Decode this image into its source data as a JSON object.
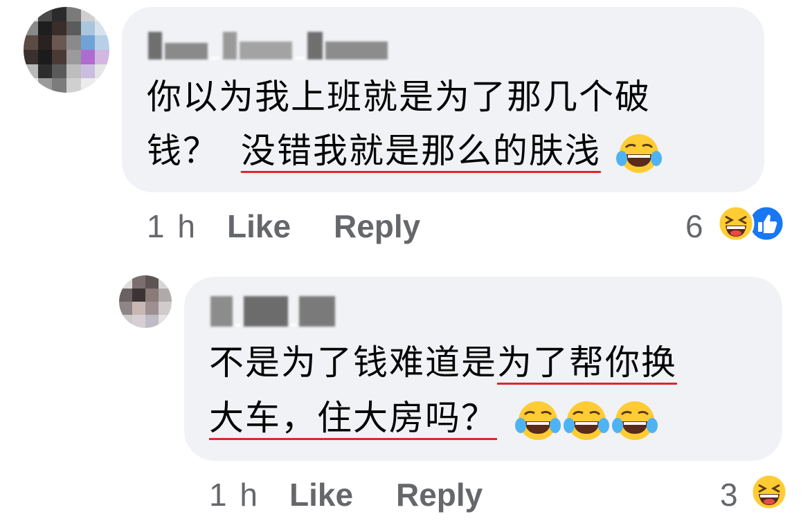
{
  "comments": [
    {
      "author": "",
      "text_line1": "你以为我上班就是为了那几个破",
      "text_line2_plain": "钱？",
      "text_line2_underlined": "没错我就是那么的肤浅",
      "emoji_after": [
        "tears-of-joy"
      ],
      "timestamp": "1 h",
      "like_label": "Like",
      "reply_label": "Reply",
      "reaction_count": "6",
      "reactions": [
        "laughing-face",
        "like-thumb"
      ]
    },
    {
      "author": "",
      "text_line1_plain": "不是为了钱难道是",
      "text_line1_underlined": "为了帮你换",
      "text_line2_underlined": "大车，住大房吗？",
      "emoji_after": [
        "tears-of-joy",
        "tears-of-joy",
        "tears-of-joy"
      ],
      "timestamp": "1 h",
      "like_label": "Like",
      "reply_label": "Reply",
      "reaction_count": "3",
      "reactions": [
        "laughing-face"
      ]
    }
  ],
  "colors": {
    "bubble": "#f0f2f5",
    "meta_text": "#65676b",
    "underline": "#e0242b",
    "like_blue": "#1877f2",
    "emoji_yellow": "#ffcc33"
  }
}
